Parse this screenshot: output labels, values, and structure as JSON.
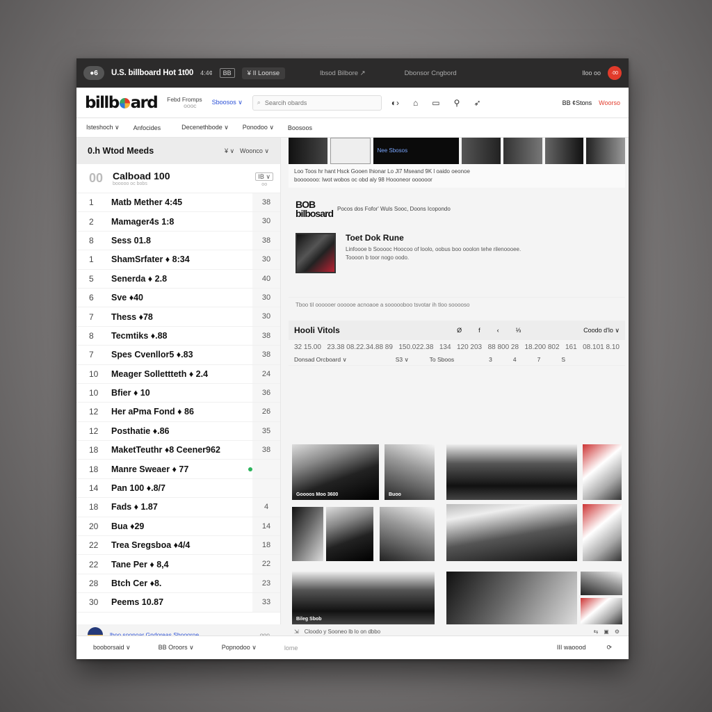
{
  "titlebar": {
    "toggle": "●6",
    "title": "U.S. billboard Hot 1t00",
    "small": "4:4¢",
    "box": "BB",
    "dropdown": "¥ Il Loonse",
    "center1": "lbsod Bilbore ↗",
    "center2": "Dbonsor Cngbord",
    "right_small": "lloo oo",
    "red_button": "·00"
  },
  "nav": {
    "logo_left": "billb",
    "logo_right": "ard",
    "sub1": "Febd Fromps",
    "sub2": "oooc",
    "dropdown": "Sboosos ∨",
    "search_placeholder": "Searcih obards",
    "right_a": "BB ¢Stons",
    "right_red": "Woorso"
  },
  "subnav": {
    "items": [
      "Isteshoch ∨",
      "Anfocides",
      "Decenethbode ∨",
      "Ponodoo ∨",
      "Boosoos"
    ]
  },
  "left": {
    "header_title": "0.h Wtod Meeds",
    "ctrl1": "¥ ∨",
    "ctrl2": "Woonco ∨",
    "chart_num": "00",
    "chart_title": "Calboad 100",
    "chart_sub": "booooo oc bobs",
    "chart_ctrl": "IB ∨",
    "chart_ctrl_sub": "oo",
    "rows": [
      {
        "rank": "1",
        "song": "Matb Mether 4:45",
        "last": "38"
      },
      {
        "rank": "2",
        "song": "Mamager4s 1:8",
        "last": "30"
      },
      {
        "rank": "8",
        "song": "Sess 01.8",
        "last": "38"
      },
      {
        "rank": "1",
        "song": "ShamSrfater ♦ 8:34",
        "last": "30"
      },
      {
        "rank": "5",
        "song": "Senerda ♦ 2.8",
        "last": "40"
      },
      {
        "rank": "6",
        "song": "Sve ♦40",
        "last": "30"
      },
      {
        "rank": "7",
        "song": "Thess ♦78",
        "last": "30"
      },
      {
        "rank": "8",
        "song": "Tecmtiks ♦.88",
        "last": "38"
      },
      {
        "rank": "7",
        "song": "Spes Cvenllor5 ♦.83",
        "last": "38"
      },
      {
        "rank": "10",
        "song": "Meager Sollettteth ♦ 2.4",
        "last": "24"
      },
      {
        "rank": "10",
        "song": "Bfier ♦ 10",
        "last": "36"
      },
      {
        "rank": "12",
        "song": "Her aPma Fond ♦ 86",
        "last": "26"
      },
      {
        "rank": "12",
        "song": "Posthatie ♦.86",
        "last": "35"
      },
      {
        "rank": "18",
        "song": "MaketTeuthr ♦8 Ceener962",
        "last": "38"
      },
      {
        "rank": "18",
        "song": "Manre Sweaer ♦ 77",
        "last": "",
        "dot": true
      },
      {
        "rank": "14",
        "song": "Pan 100 ♦.8/7",
        "last": ""
      },
      {
        "rank": "18",
        "song": "Fads ♦ 1.87",
        "last": "4"
      },
      {
        "rank": "20",
        "song": "Bua ♦29",
        "last": "14"
      },
      {
        "rank": "22",
        "song": "Trea Sregsboa ♦4/4",
        "last": "18"
      },
      {
        "rank": "22",
        "song": "Tane Per ♦ 8,4",
        "last": "22"
      },
      {
        "rank": "28",
        "song": "Btch Cer ♦8.",
        "last": "23"
      },
      {
        "rank": "30",
        "song": "Peems 10.87",
        "last": "33"
      }
    ],
    "footer_text": "lboo soonoar Gndoreas Sboooroe",
    "footer_right": "ooo"
  },
  "right": {
    "strip_label": "Nee Sbosos",
    "news_line1": "Loo Toos hr hant Hsck Gooen lhionar Lo Jl7 Mseand 9K l oaido oeonoe",
    "news_line2": "booooooo: Iwot wobos oc obd aly 98 Hoooneor oooooor",
    "mini_logo": "BOB bilbosard",
    "mini_text": "Pocos dos Fofor' Wuls Sooc, Doons Icopondo",
    "feature_title": "Toet Dok Rune",
    "feature_desc1": "Linfoooe b Sooooc Hoocoo of loolo, oobus boo ooolon tehe rilenoooee.",
    "feature_desc2": "Toooon b toor nogo oodo.",
    "divider_text": "Tboo til oooooer oooooe acnoaoe a soooooboo tsvotar ih tloo sooooso",
    "hot_title": "Hooli Vitols",
    "hot_ctrl": [
      "Ø",
      "f",
      "‹",
      "⅓"
    ],
    "hot_right": "Coodo d'lo ∨",
    "hot_nums": [
      "32 15.00",
      "23.38 08.22.34.88 89",
      "150.022.38",
      "134",
      "120 203",
      "88 800 28",
      "18.200 802",
      "161",
      "08.101 8.10"
    ],
    "hot_bottom": [
      "Donsad Orcboard ∨",
      "S3 ∨",
      "To Sboos",
      "3",
      "4",
      "7",
      "S"
    ],
    "captions": [
      "Goooos Moo 3600",
      "Buoo",
      "Bileg Sbob"
    ],
    "footer": "Cloodo y Sooneo lb lo on dbbo"
  },
  "bottombar": {
    "items": [
      "booborsaid ∨",
      "BB Oroors ∨",
      "Popnodoo ∨",
      "lome"
    ],
    "right": "III waoood",
    "right2": "⟳"
  },
  "colors": {
    "accent_red": "#e23b2b",
    "link_blue": "#2a4fd6",
    "titlebar": "#2c2b2b"
  }
}
